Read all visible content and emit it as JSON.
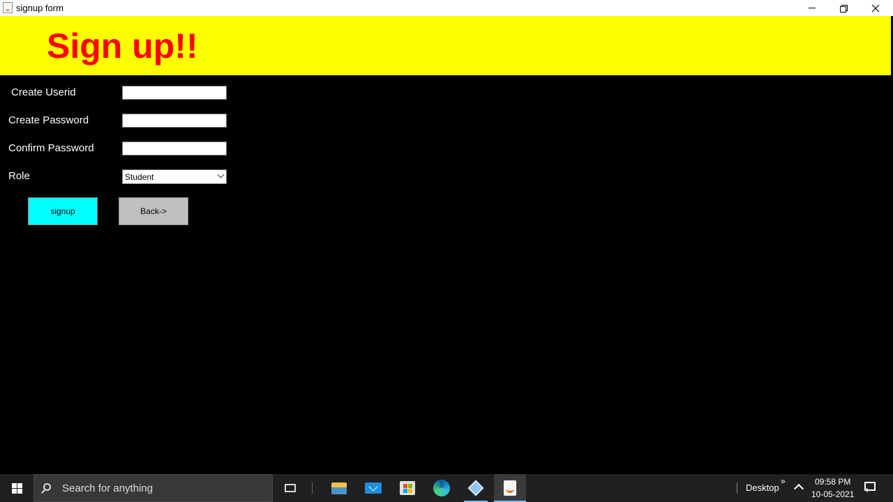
{
  "window": {
    "title": "signup form",
    "icon": "java-cup-icon",
    "controls": [
      "minimize-icon",
      "maximize-icon",
      "close-icon"
    ]
  },
  "header": {
    "title": "Sign up!!",
    "background_color": "#ffff00",
    "title_color": "#ff0000"
  },
  "form": {
    "userid_label": "Create Userid",
    "userid_value": "",
    "password_label": "Create Password",
    "password_value": "",
    "confirm_label": "Confirm Password",
    "confirm_value": "",
    "role_label": "Role",
    "role_selected": "Student"
  },
  "buttons": {
    "signup_label": "signup",
    "signup_color": "#00ffff",
    "back_label": "Back->",
    "back_color": "#c0c0c0"
  },
  "taskbar": {
    "search_placeholder": "Search for anything",
    "pinned": [
      "task-view-icon",
      "file-explorer-icon",
      "mail-icon",
      "store-icon",
      "edge-icon",
      "app-cube-icon",
      "java-icon"
    ],
    "desktop_label": "Desktop",
    "overflow_glyph": "»",
    "time": "09:58 PM",
    "date": "10-05-2021"
  }
}
